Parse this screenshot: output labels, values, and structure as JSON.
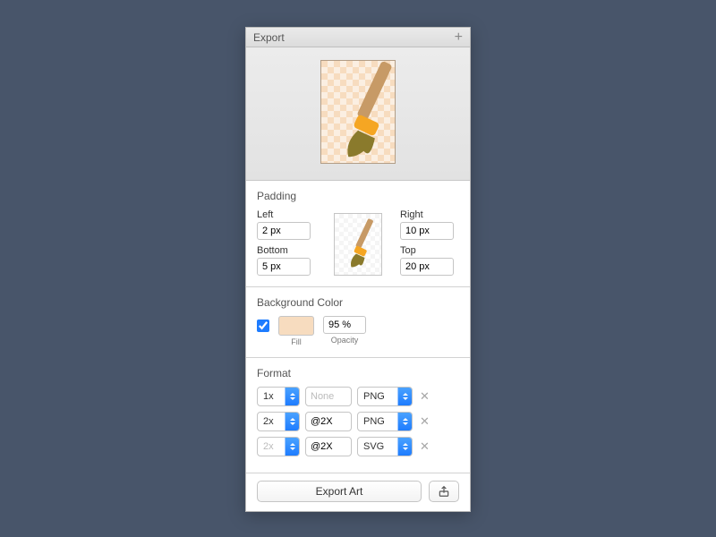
{
  "title": "Export",
  "padding": {
    "section_title": "Padding",
    "left_label": "Left",
    "left_value": "2 px",
    "right_label": "Right",
    "right_value": "10 px",
    "bottom_label": "Bottom",
    "bottom_value": "5 px",
    "top_label": "Top",
    "top_value": "20 px"
  },
  "background": {
    "section_title": "Background Color",
    "checked": true,
    "fill_label": "Fill",
    "opacity_value": "95 %",
    "opacity_label": "Opacity",
    "fill_color": "#f7dcbf"
  },
  "format": {
    "section_title": "Format",
    "suffix_placeholder": "None",
    "rows": [
      {
        "scale": "1x",
        "suffix": "",
        "type": "PNG",
        "scale_disabled": false
      },
      {
        "scale": "2x",
        "suffix": "@2X",
        "type": "PNG",
        "scale_disabled": false
      },
      {
        "scale": "2x",
        "suffix": "@2X",
        "type": "SVG",
        "scale_disabled": true
      }
    ]
  },
  "footer": {
    "export_label": "Export Art"
  }
}
